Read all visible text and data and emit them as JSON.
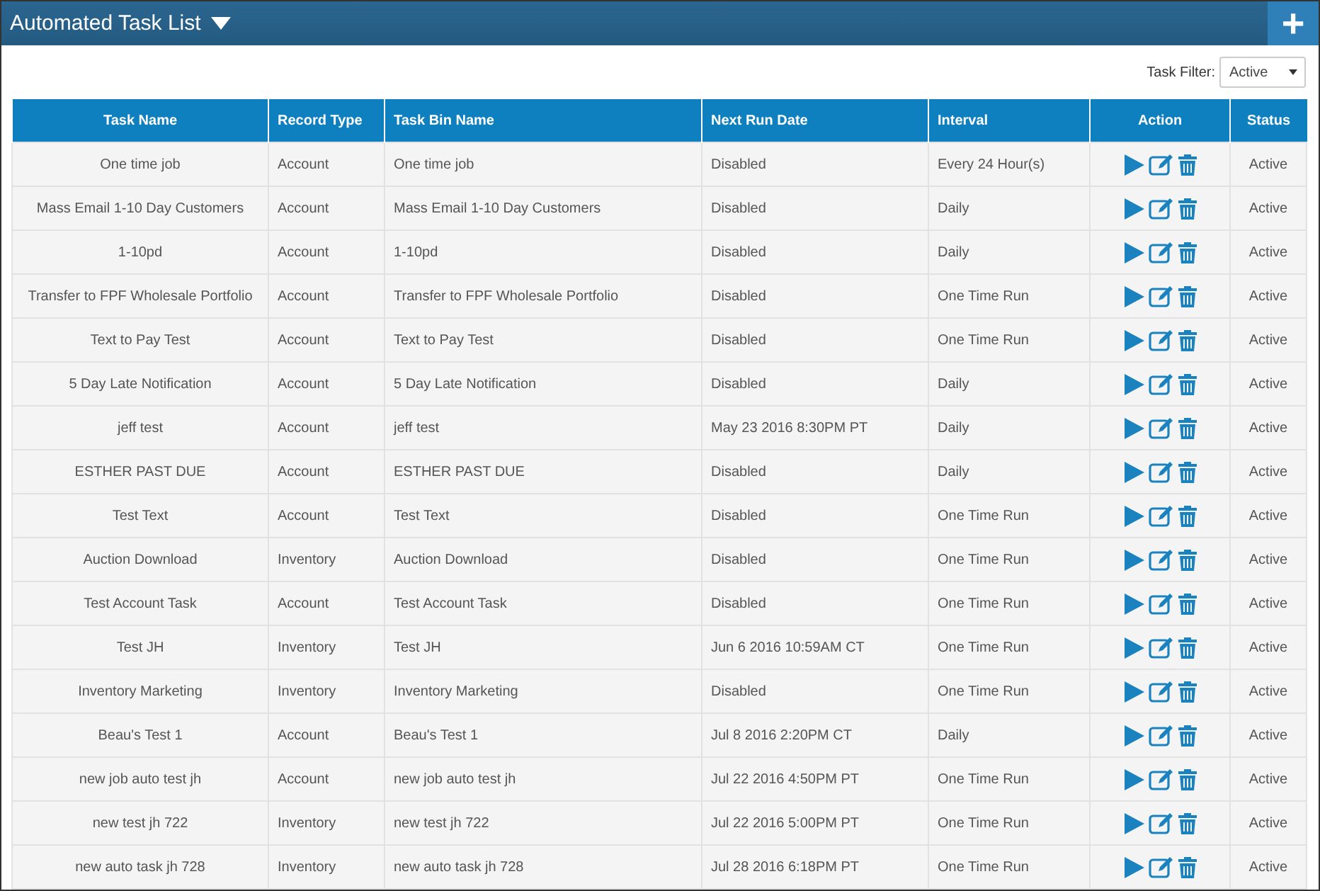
{
  "header": {
    "title": "Automated Task List",
    "add_button": "+"
  },
  "filter": {
    "label": "Task Filter:",
    "value": "Active"
  },
  "table": {
    "columns": [
      "Task Name",
      "Record Type",
      "Task Bin Name",
      "Next Run Date",
      "Interval",
      "Action",
      "Status"
    ],
    "rows": [
      {
        "task_name": "One time job",
        "record_type": "Account",
        "task_bin_name": "One time job",
        "next_run_date": "Disabled",
        "interval": "Every 24 Hour(s)",
        "status": "Active"
      },
      {
        "task_name": "Mass Email 1-10 Day Customers",
        "record_type": "Account",
        "task_bin_name": "Mass Email 1-10 Day Customers",
        "next_run_date": "Disabled",
        "interval": "Daily",
        "status": "Active"
      },
      {
        "task_name": "1-10pd",
        "record_type": "Account",
        "task_bin_name": "1-10pd",
        "next_run_date": "Disabled",
        "interval": "Daily",
        "status": "Active"
      },
      {
        "task_name": "Transfer to FPF Wholesale Portfolio",
        "record_type": "Account",
        "task_bin_name": "Transfer to FPF Wholesale Portfolio",
        "next_run_date": "Disabled",
        "interval": "One Time Run",
        "status": "Active"
      },
      {
        "task_name": "Text to Pay Test",
        "record_type": "Account",
        "task_bin_name": "Text to Pay Test",
        "next_run_date": "Disabled",
        "interval": "One Time Run",
        "status": "Active"
      },
      {
        "task_name": "5 Day Late Notification",
        "record_type": "Account",
        "task_bin_name": "5 Day Late Notification",
        "next_run_date": "Disabled",
        "interval": "Daily",
        "status": "Active"
      },
      {
        "task_name": "jeff test",
        "record_type": "Account",
        "task_bin_name": "jeff test",
        "next_run_date": "May 23 2016 8:30PM PT",
        "interval": "Daily",
        "status": "Active"
      },
      {
        "task_name": "ESTHER PAST DUE",
        "record_type": "Account",
        "task_bin_name": "ESTHER PAST DUE",
        "next_run_date": "Disabled",
        "interval": "Daily",
        "status": "Active"
      },
      {
        "task_name": "Test Text",
        "record_type": "Account",
        "task_bin_name": "Test Text",
        "next_run_date": "Disabled",
        "interval": "One Time Run",
        "status": "Active"
      },
      {
        "task_name": "Auction Download",
        "record_type": "Inventory",
        "task_bin_name": "Auction Download",
        "next_run_date": "Disabled",
        "interval": "One Time Run",
        "status": "Active"
      },
      {
        "task_name": "Test Account Task",
        "record_type": "Account",
        "task_bin_name": "Test Account Task",
        "next_run_date": "Disabled",
        "interval": "One Time Run",
        "status": "Active"
      },
      {
        "task_name": "Test JH",
        "record_type": "Inventory",
        "task_bin_name": "Test JH",
        "next_run_date": "Jun 6 2016 10:59AM CT",
        "interval": "One Time Run",
        "status": "Active"
      },
      {
        "task_name": "Inventory Marketing",
        "record_type": "Inventory",
        "task_bin_name": "Inventory Marketing",
        "next_run_date": "Disabled",
        "interval": "One Time Run",
        "status": "Active"
      },
      {
        "task_name": "Beau's Test 1",
        "record_type": "Account",
        "task_bin_name": "Beau's Test 1",
        "next_run_date": "Jul 8 2016 2:20PM CT",
        "interval": "Daily",
        "status": "Active"
      },
      {
        "task_name": "new job auto test jh",
        "record_type": "Account",
        "task_bin_name": "new job auto test jh",
        "next_run_date": "Jul 22 2016 4:50PM PT",
        "interval": "One Time Run",
        "status": "Active"
      },
      {
        "task_name": "new test jh 722",
        "record_type": "Inventory",
        "task_bin_name": "new test jh 722",
        "next_run_date": "Jul 22 2016 5:00PM PT",
        "interval": "One Time Run",
        "status": "Active"
      },
      {
        "task_name": "new auto task jh 728",
        "record_type": "Inventory",
        "task_bin_name": "new auto task jh 728",
        "next_run_date": "Jul 28 2016 6:18PM PT",
        "interval": "One Time Run",
        "status": "Active"
      }
    ]
  }
}
